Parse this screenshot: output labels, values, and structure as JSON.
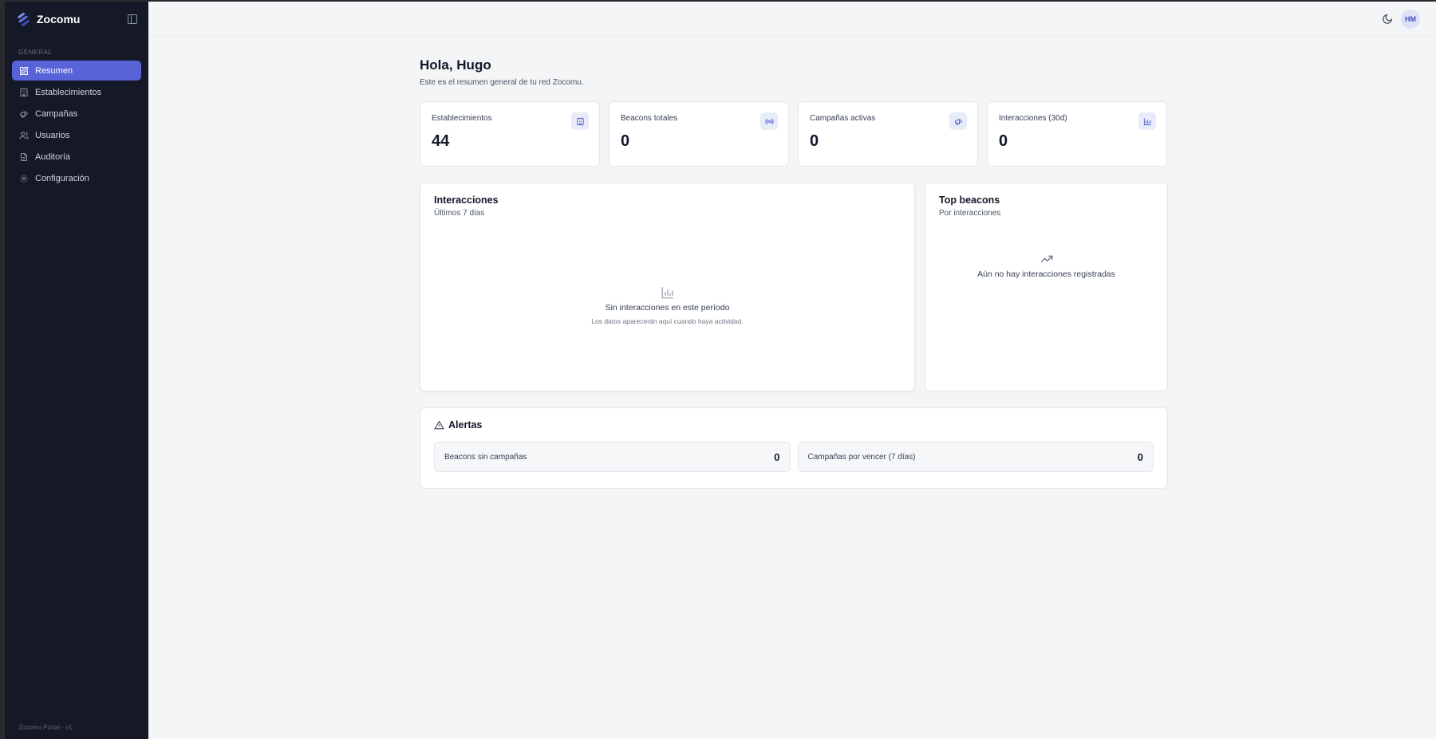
{
  "app": {
    "name": "Zocomu",
    "footer": "Zocomu Portal · v1"
  },
  "sidebar": {
    "section_label": "GENERAL",
    "items": [
      {
        "label": "Resumen",
        "icon": "layout-grid-icon",
        "active": true
      },
      {
        "label": "Establecimientos",
        "icon": "building-icon",
        "active": false
      },
      {
        "label": "Campañas",
        "icon": "megaphone-icon",
        "active": false
      },
      {
        "label": "Usuarios",
        "icon": "users-icon",
        "active": false
      },
      {
        "label": "Auditoría",
        "icon": "file-text-icon",
        "active": false
      },
      {
        "label": "Configuración",
        "icon": "gear-icon",
        "active": false
      }
    ]
  },
  "topbar": {
    "avatar_initials": "HM",
    "theme_icon": "moon-icon"
  },
  "page": {
    "greeting": "Hola, Hugo",
    "subtitle": "Este es el resumen general de tu red Zocomu."
  },
  "stats": [
    {
      "label": "Establecimientos",
      "value": "44",
      "icon": "building-icon"
    },
    {
      "label": "Beacons totales",
      "value": "0",
      "icon": "radio-icon"
    },
    {
      "label": "Campañas activas",
      "value": "0",
      "icon": "megaphone-icon"
    },
    {
      "label": "Interacciones (30d)",
      "value": "0",
      "icon": "bar-chart-icon"
    }
  ],
  "interactions_panel": {
    "title": "Interacciones",
    "subtitle": "Últimos 7 días",
    "empty_title": "Sin interacciones en este período",
    "empty_desc": "Los datos aparecerán aquí cuando haya actividad."
  },
  "top_beacons_panel": {
    "title": "Top beacons",
    "subtitle": "Por interacciones",
    "empty_title": "Aún no hay interacciones registradas"
  },
  "alerts": {
    "title": "Alertas",
    "items": [
      {
        "label": "Beacons sin campañas",
        "value": "0"
      },
      {
        "label": "Campañas por vencer (7 días)",
        "value": "0"
      }
    ]
  },
  "colors": {
    "accent": "#5763d6",
    "sidebar_bg": "#141827",
    "page_bg": "#f4f5f7"
  }
}
